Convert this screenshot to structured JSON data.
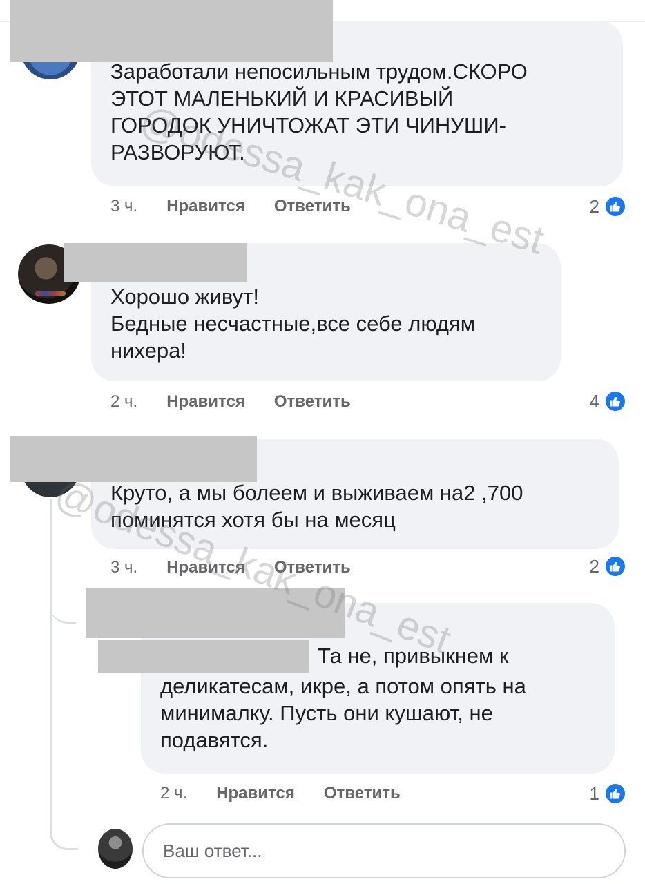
{
  "comments": [
    {
      "text": "Заработали непосильным трудом.СКОРО\nЭТОТ МАЛЕНЬКИЙ И КРАСИВЫЙ\nГОРОДОК УНИЧТОЖАТ ЭТИ ЧИНУШИ-\nРАЗВОРУЮТ.",
      "time": "3 ч.",
      "like_label": "Нравится",
      "reply_label": "Ответить",
      "reaction_count": "2"
    },
    {
      "text": "Хорошо живут!\nБедные несчастные,все себе людям\nнихера!",
      "time": "2 ч.",
      "like_label": "Нравится",
      "reply_label": "Ответить",
      "reaction_count": "4"
    },
    {
      "text": "Круто, а мы болеем и выживаем на2 ,700\nпоминятся хотя бы на месяц",
      "time": "3 ч.",
      "like_label": "Нравится",
      "reply_label": "Ответить",
      "reaction_count": "2"
    },
    {
      "text_first_line": "Та не, привыкнем к",
      "text_rest": "деликатесам, икре, а потом опять на\nминималку. Пусть они кушают, не\nподавятся.",
      "time": "2 ч.",
      "like_label": "Нравится",
      "reply_label": "Ответить",
      "reaction_count": "1"
    }
  ],
  "reply_box": {
    "placeholder": "Ваш ответ..."
  },
  "watermark": "@odessa_kak_ona_est",
  "colors": {
    "bubble": "#f0f2f5",
    "like_blue": "#1877f2",
    "meta_gray": "#65676b",
    "redaction": "#c6c6c6"
  },
  "icons": [
    "like-icon"
  ]
}
